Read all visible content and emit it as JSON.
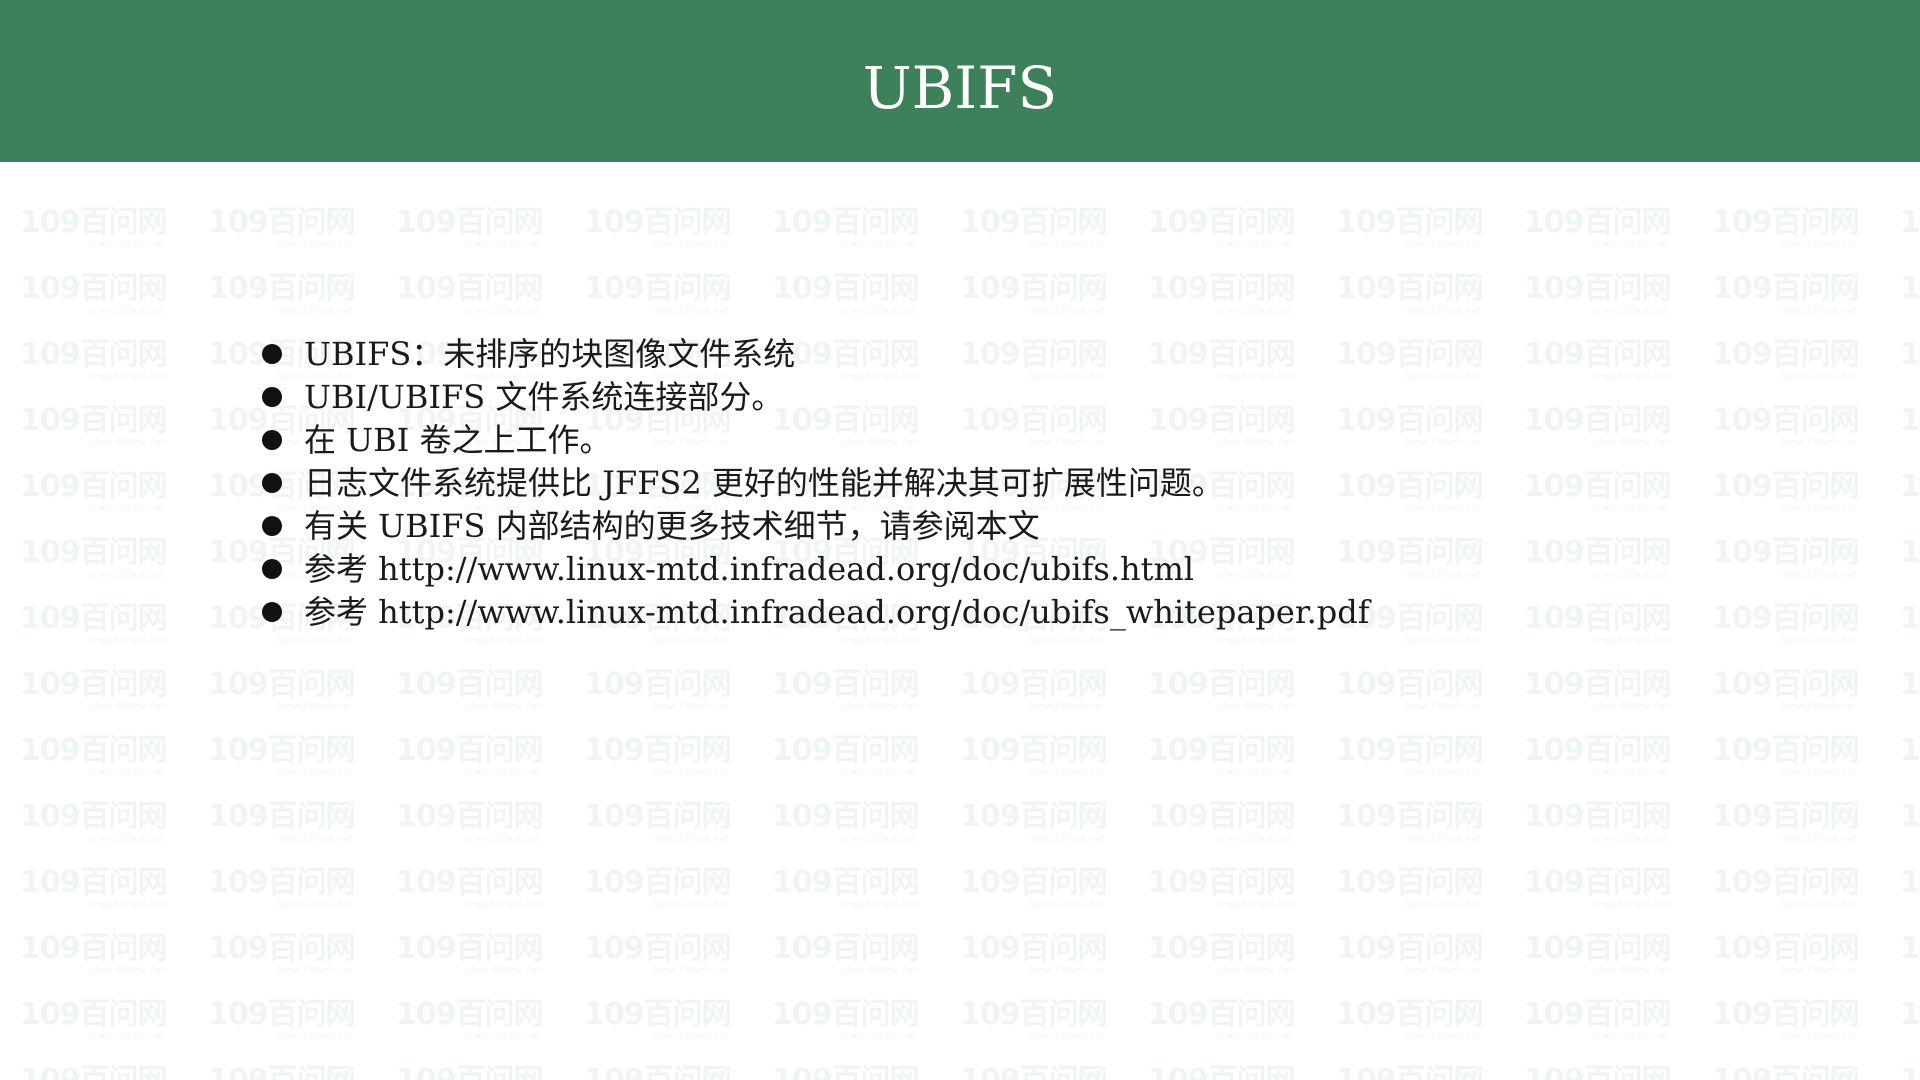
{
  "slide": {
    "title": "UBIFS",
    "bullets": [
      "UBIFS：未排序的块图像文件系统",
      "UBI/UBIFS 文件系统连接部分。",
      "在 UBI 卷之上工作。",
      "日志文件系统提供比 JFFS2 更好的性能并解决其可扩展性问题。",
      "有关 UBIFS 内部结构的更多技术细节，请参阅本文",
      "参考 http://www.linux-mtd.infradead.org/doc/ubifs.html",
      "参考 http://www.linux-mtd.infradead.org/doc/ubifs_whitepaper.pdf"
    ]
  },
  "watermark": {
    "logo_text": "109百问网",
    "url_text": "www.100ask.net"
  },
  "colors": {
    "header_bg": "#3e805a",
    "title_text": "#ffffff",
    "body_text": "#1a1a1a",
    "watermark": "#2e8b57"
  }
}
